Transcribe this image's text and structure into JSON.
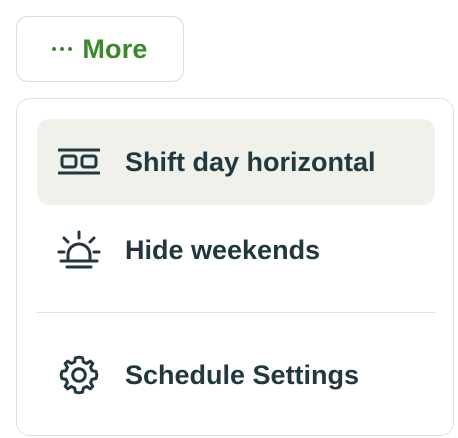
{
  "more_button": {
    "label": "More",
    "icon": "ellipsis-icon"
  },
  "menu": {
    "items": [
      {
        "label": "Shift day horizontal",
        "icon": "columns-layout-icon",
        "active": true
      },
      {
        "label": "Hide weekends",
        "icon": "alarm-light-icon",
        "active": false
      },
      {
        "label": "Schedule Settings",
        "icon": "gear-icon",
        "active": false
      }
    ]
  },
  "colors": {
    "accent": "#3a8a2c",
    "text": "#22383f",
    "active_bg": "#f1f1ec",
    "border": "#d9dcd8"
  }
}
